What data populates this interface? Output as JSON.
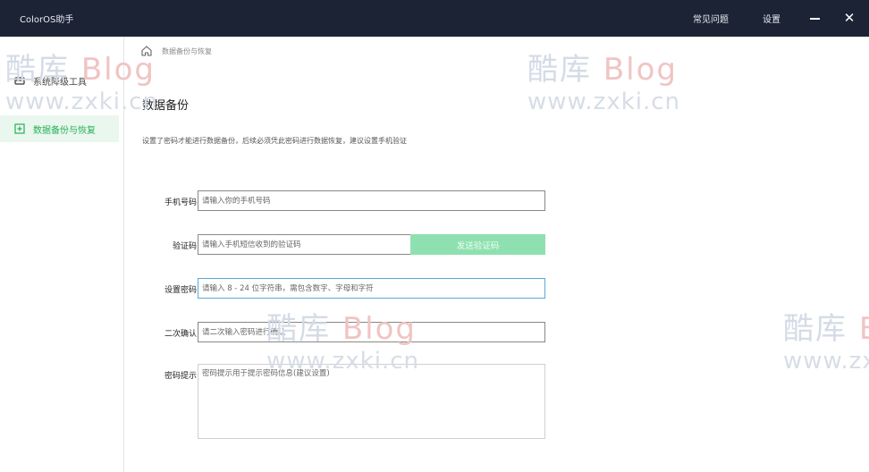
{
  "window": {
    "app_title": "ColorOS助手",
    "faq_label": "常见问题",
    "settings_label": "设置",
    "minimize_icon": "minimize-icon",
    "close_label": "✕"
  },
  "sidebar": {
    "items": [
      {
        "label": "系统降级工具",
        "icon": "downgrade-icon",
        "active": false
      },
      {
        "label": "数据备份与恢复",
        "icon": "backup-icon",
        "active": true
      }
    ],
    "active_color": "#23b055"
  },
  "breadcrumb": {
    "home_icon": "home-icon",
    "label": "数据备份与恢复"
  },
  "main": {
    "title": "数据备份",
    "hint": "设置了密码才能进行数据备份，后续必须凭此密码进行数据恢复，建议设置手机验证"
  },
  "form": {
    "phone": {
      "label": "手机号码",
      "placeholder": "请输入你的手机号码",
      "value": ""
    },
    "code": {
      "label": "验证码",
      "placeholder": "请输入手机短信收到的验证码",
      "value": "",
      "button": "发送验证码"
    },
    "password": {
      "label": "设置密码",
      "placeholder": "请输入 8 - 24 位字符串，需包含数字、字母和字符",
      "value": ""
    },
    "confirm": {
      "label": "二次确认",
      "placeholder": "请二次输入密码进行确认",
      "value": ""
    },
    "password_hint": {
      "label": "密码提示",
      "placeholder": "密码提示用于提示密码信息(建议设置)",
      "value": ""
    }
  },
  "watermark": {
    "brand_cn": "酷库",
    "brand_en": "Blog",
    "url": "www.zxki.cn"
  },
  "colors": {
    "titlebar": "#1c2335",
    "send_button": "#8fe0b0",
    "focus_border": "#5aa9d6"
  }
}
